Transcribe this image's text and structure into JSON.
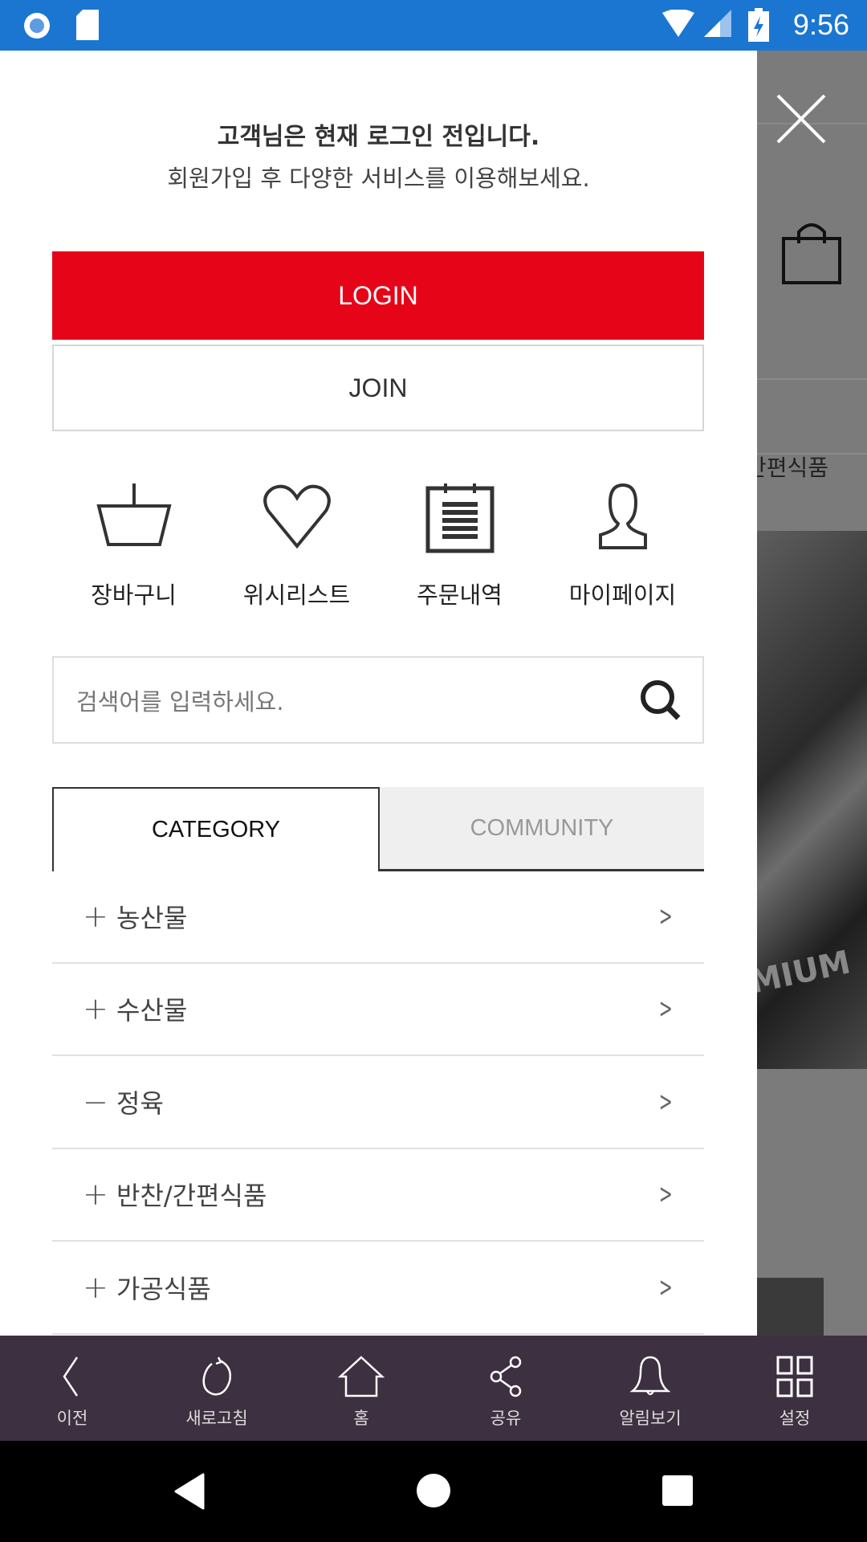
{
  "status_bar": {
    "time": "9:56",
    "color": "#1b76d1"
  },
  "drawer": {
    "message_bold": "고객님은 현재 로그인 전입니다.",
    "message": "회원가입 후 다양한 서비스를 이용해보세요.",
    "login_label": "LOGIN",
    "join_label": "JOIN",
    "login_color": "#e60518",
    "quick_links": [
      {
        "label": "장바구니",
        "icon": "basket-icon"
      },
      {
        "label": "위시리스트",
        "icon": "heart-icon"
      },
      {
        "label": "주문내역",
        "icon": "order-list-icon"
      },
      {
        "label": "마이페이지",
        "icon": "user-icon"
      }
    ],
    "search": {
      "placeholder": "검색어를 입력하세요."
    },
    "tabs": [
      {
        "label": "CATEGORY",
        "active": true
      },
      {
        "label": "COMMUNITY",
        "active": false
      }
    ],
    "categories": [
      {
        "sign": "+",
        "label": "농산물"
      },
      {
        "sign": "−",
        "label": "수산물"
      },
      {
        "sign": "−",
        "label": "정육"
      },
      {
        "sign": "+",
        "label": "반찬/간편식품"
      },
      {
        "sign": "+",
        "label": "가공식품"
      }
    ]
  },
  "background": {
    "category_text": "간편식품",
    "stamp_text": "MIUM"
  },
  "bottom_nav": {
    "color": "#3d3040",
    "items": [
      {
        "label": "이전",
        "icon": "back-icon"
      },
      {
        "label": "새로고침",
        "icon": "refresh-icon"
      },
      {
        "label": "홈",
        "icon": "home-icon"
      },
      {
        "label": "공유",
        "icon": "share-icon"
      },
      {
        "label": "알림보기",
        "icon": "bell-icon"
      },
      {
        "label": "설정",
        "icon": "grid-icon"
      }
    ]
  }
}
